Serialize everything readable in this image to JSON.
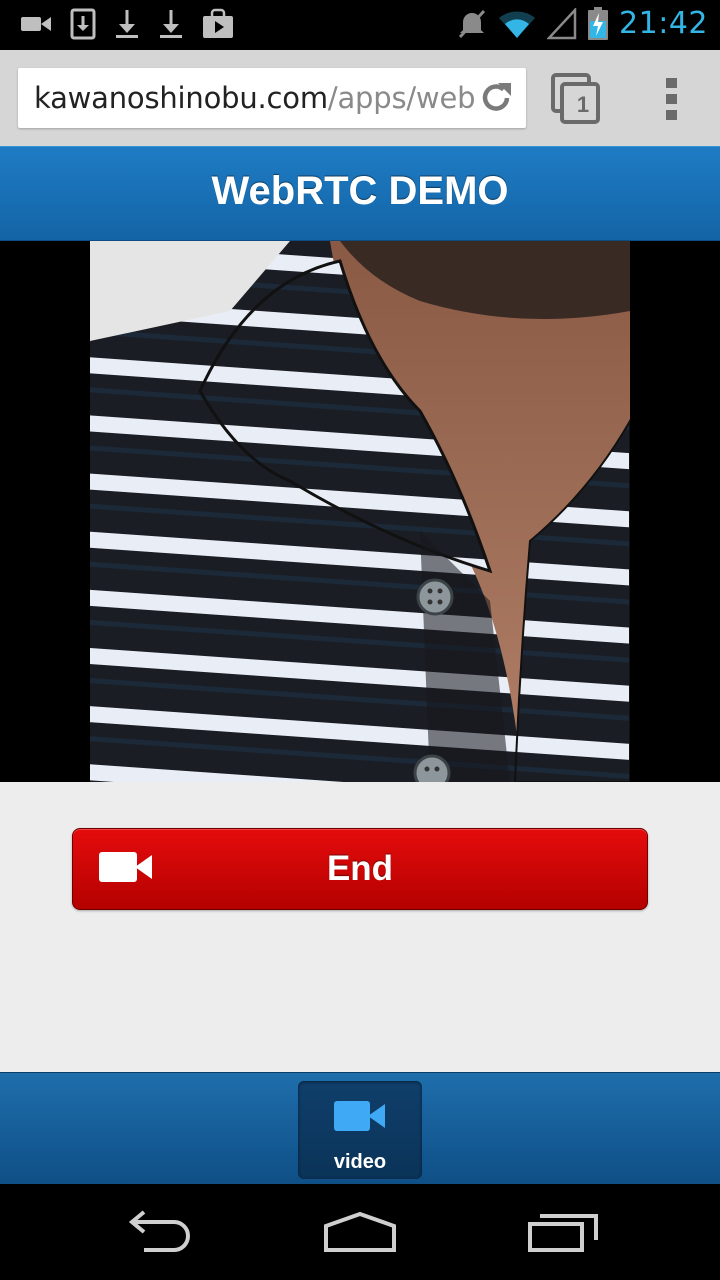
{
  "status_bar": {
    "time": "21:42",
    "left_icons": [
      "video-camera-icon",
      "download-box-icon",
      "download-icon",
      "download-icon",
      "play-store-icon"
    ],
    "right_icons": [
      "mute-icon",
      "wifi-icon",
      "signal-icon",
      "battery-charging-icon"
    ]
  },
  "browser": {
    "url_host": "kawanoshinobu.com",
    "url_path": "/apps/web",
    "tab_count": "1"
  },
  "header": {
    "title": "WebRTC DEMO"
  },
  "call": {
    "end_label": "End"
  },
  "footer_nav": {
    "video_label": "video"
  },
  "colors": {
    "accent": "#33b5e5",
    "header_blue": "#1a70b6",
    "end_red": "#d40606"
  }
}
